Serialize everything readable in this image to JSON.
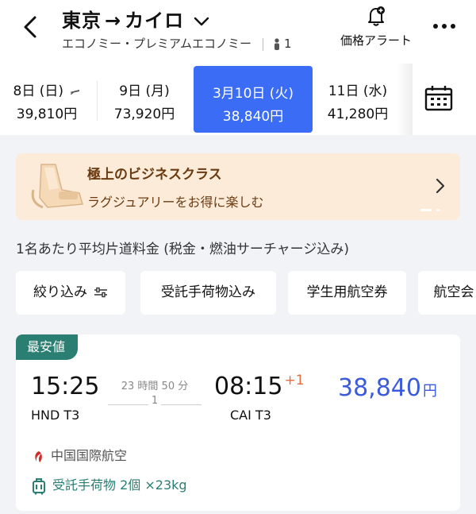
{
  "header": {
    "origin": "東京",
    "arrow": "→",
    "destination": "カイロ",
    "cabin": "エコノミー・プレミアムエコノミー",
    "passengers": "1",
    "price_alert_label": "価格アラート"
  },
  "dates": [
    {
      "day": "8日 (日)",
      "price": "39,810円",
      "selected": false
    },
    {
      "day": "9日 (月)",
      "price": "73,920円",
      "selected": false
    },
    {
      "day": "3月10日 (火)",
      "price": "38,840円",
      "selected": true
    },
    {
      "day": "11日 (水)",
      "price": "41,280円",
      "selected": false
    }
  ],
  "banner": {
    "title": "極上のビジネスクラス",
    "subtitle": "ラグジュアリーをお得に楽しむ"
  },
  "fare_note": "1名あたり平均片道料金 (税金・燃油サーチャージ込み)",
  "filters": [
    "絞り込み",
    "受託手荷物込み",
    "学生用航空券",
    "航空会"
  ],
  "flight": {
    "badge": "最安値",
    "departure_time": "15:25",
    "departure_airport": "HND T3",
    "duration": "23 時間 50 分",
    "stops": "1",
    "arrival_time": "08:15",
    "day_offset": "+1",
    "arrival_airport": "CAI T3",
    "price": "38,840",
    "currency": "円",
    "airline": "中国国際航空",
    "baggage": "受託手荷物 2個 ×23kg"
  },
  "colors": {
    "accent": "#3b6cf6",
    "price": "#3b5bdb",
    "badge": "#2a7f72",
    "banner_bg": "#fcebd8"
  }
}
